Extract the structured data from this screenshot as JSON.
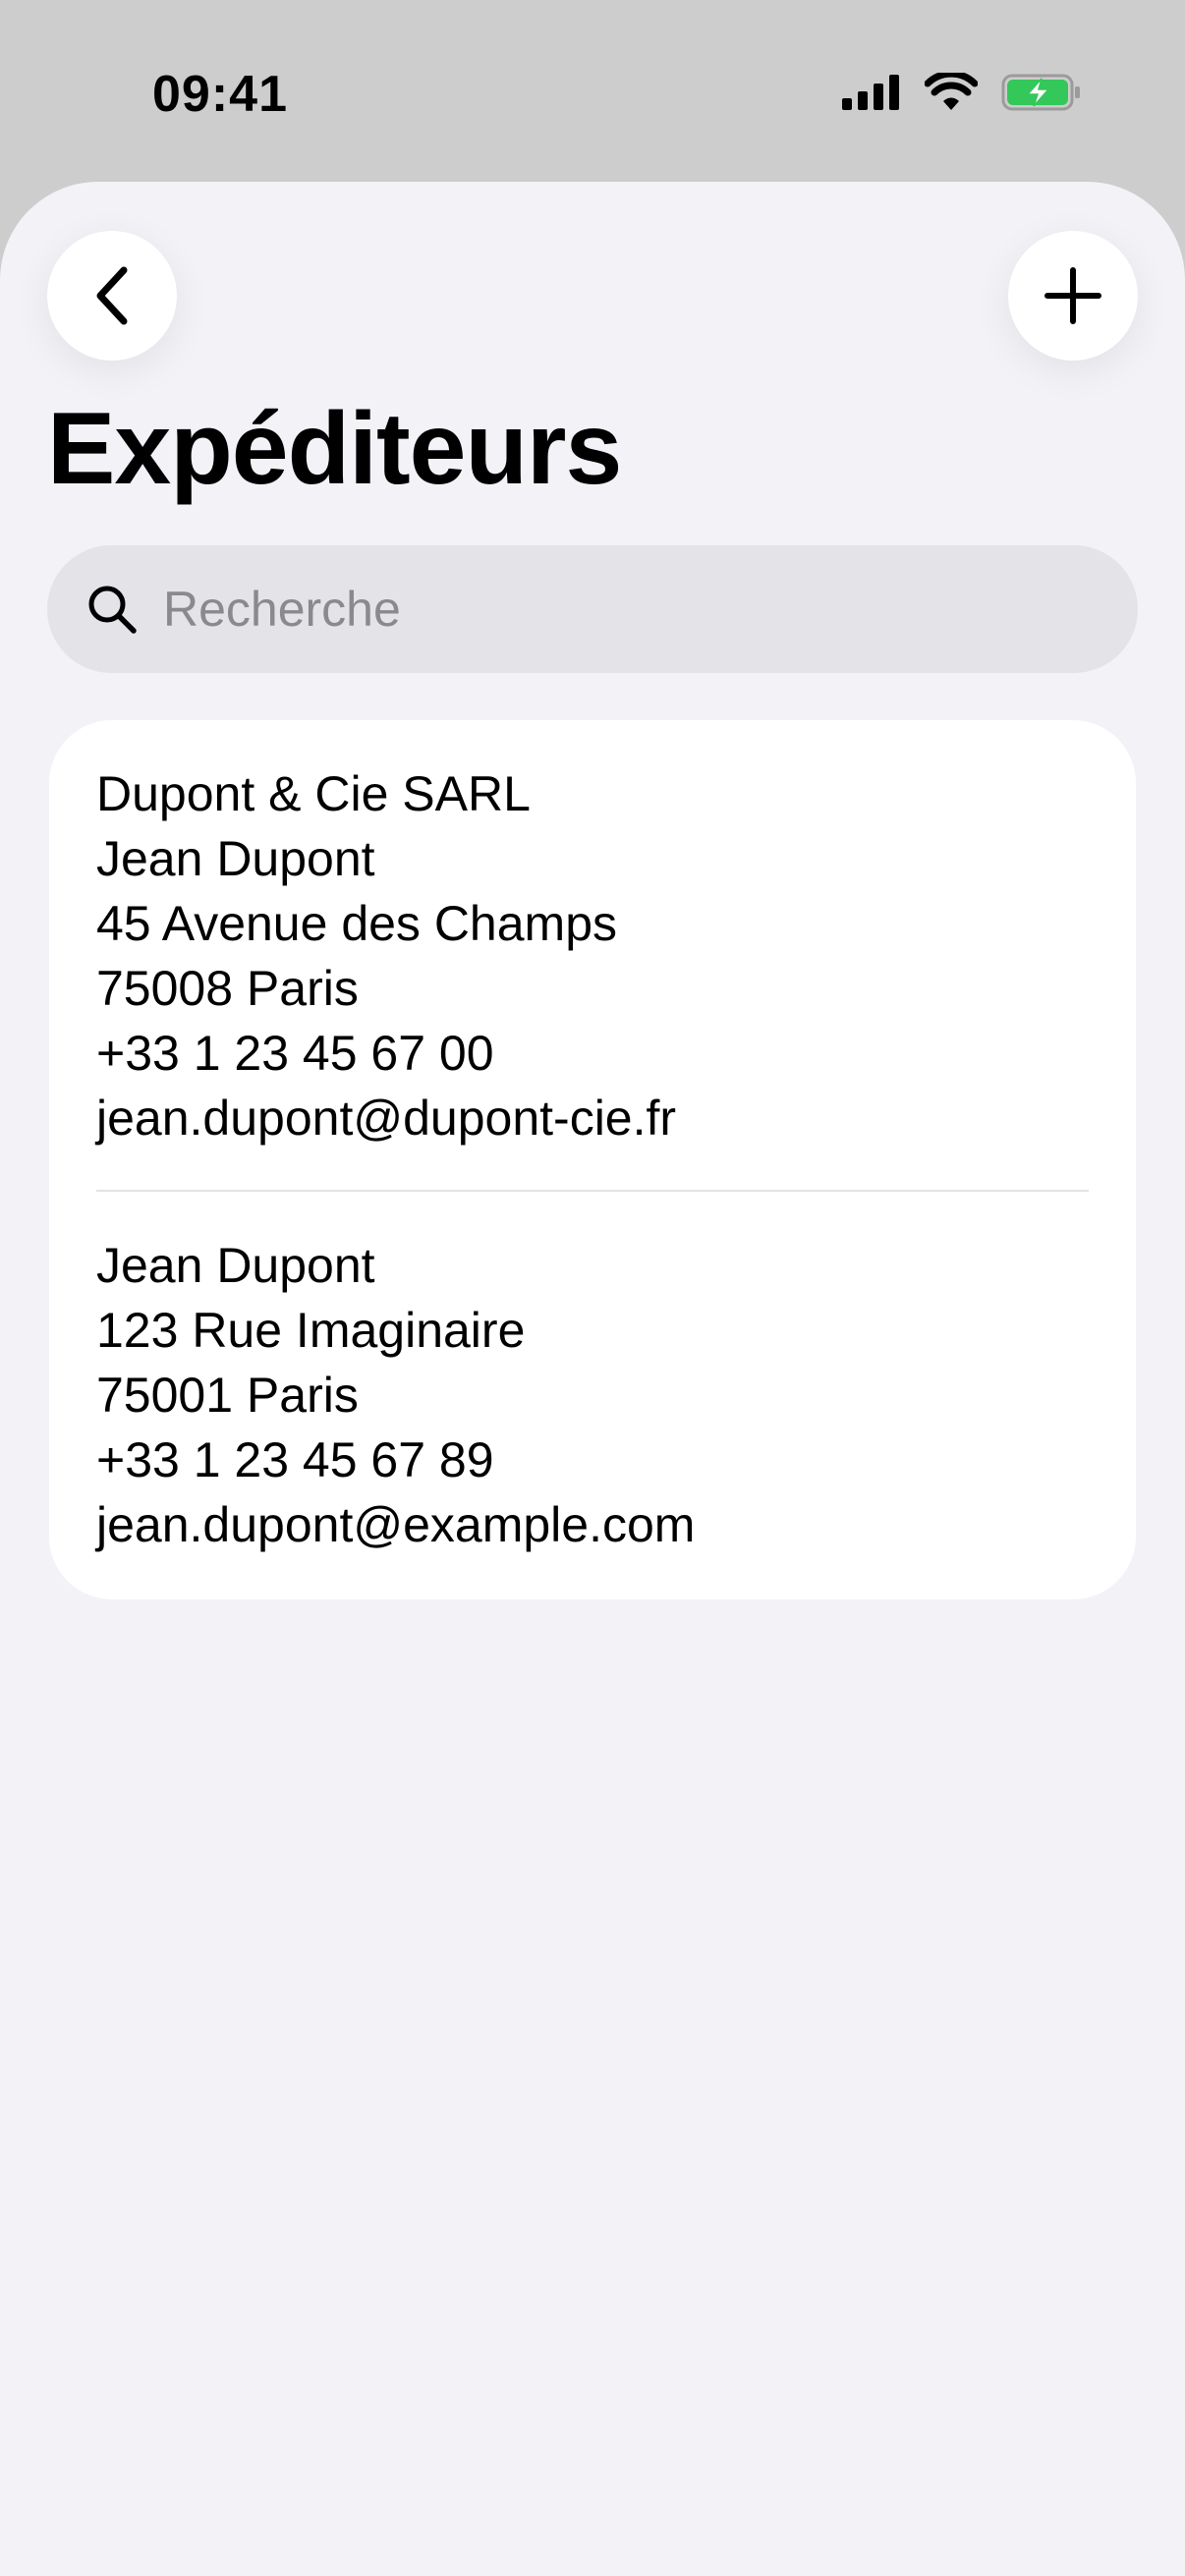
{
  "status_bar": {
    "time": "09:41"
  },
  "nav": {
    "title": "Expéditeurs",
    "back_icon": "chevron-left-icon",
    "add_icon": "plus-icon"
  },
  "search": {
    "placeholder": "Recherche",
    "value": "",
    "icon": "search-icon"
  },
  "senders": [
    {
      "lines": [
        "Dupont & Cie SARL",
        "Jean Dupont",
        "45 Avenue des Champs",
        "75008 Paris",
        "+33 1 23 45 67 00",
        "jean.dupont@dupont-cie.fr"
      ]
    },
    {
      "lines": [
        "Jean Dupont",
        "123 Rue Imaginaire",
        "75001 Paris",
        "+33 1 23 45 67 89",
        "jean.dupont@example.com"
      ]
    }
  ],
  "colors": {
    "background": "#f2f2f7",
    "status_bar": "#cdcdcd",
    "card": "#ffffff",
    "search_field": "#e3e3e8",
    "battery_green": "#34c759"
  }
}
